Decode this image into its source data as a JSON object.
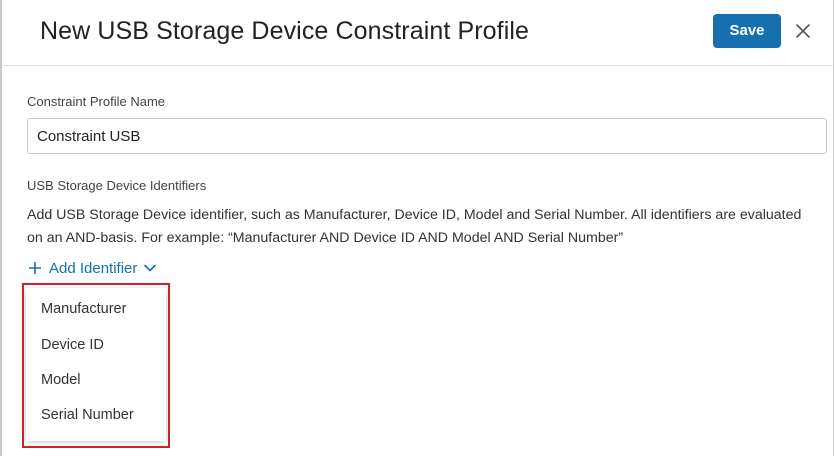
{
  "dialog": {
    "title": "New USB Storage Device Constraint Profile",
    "save_label": "Save",
    "close_icon": "close-icon"
  },
  "profile_name": {
    "label": "Constraint Profile Name",
    "value": "Constraint USB"
  },
  "identifiers": {
    "label": "USB Storage Device Identifiers",
    "description": "Add USB Storage Device identifier, such as Manufacturer, Device ID, Model and Serial Number. All identifiers are evaluated on an AND-basis. For example: “Manufacturer AND Device ID AND Model AND Serial Number”",
    "add_label": "Add Identifier",
    "add_icon": "plus-icon",
    "dropdown_icon": "chevron-down-icon",
    "menu_items": [
      {
        "label": "Manufacturer"
      },
      {
        "label": "Device ID"
      },
      {
        "label": "Model"
      },
      {
        "label": "Serial Number"
      }
    ]
  },
  "colors": {
    "accent": "#1670b0",
    "highlight": "#d0212a"
  }
}
